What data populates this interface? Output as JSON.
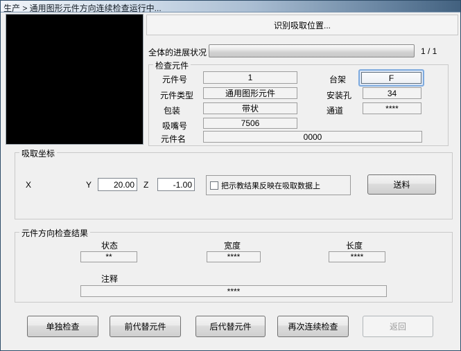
{
  "window": {
    "title": "生产 > 通用图形元件方向连续检查运行中...",
    "status_banner": "识别吸取位置...",
    "progress": {
      "label": "全体的进展状况",
      "count_text": "1 / 1"
    }
  },
  "inspect_group": {
    "title": "检查元件",
    "fields": {
      "part_no": {
        "label": "元件号",
        "value": "1"
      },
      "stage": {
        "label": "台架",
        "value": "F"
      },
      "part_type": {
        "label": "元件类型",
        "value": "通用图形元件"
      },
      "mount_hole": {
        "label": "安装孔",
        "value": "34"
      },
      "package": {
        "label": "包装",
        "value": "带状"
      },
      "channel": {
        "label": "通道",
        "value": "****"
      },
      "nozzle_no": {
        "label": "吸嘴号",
        "value": "7506"
      },
      "part_name": {
        "label": "元件名",
        "value": "0000"
      }
    }
  },
  "pickup_group": {
    "title": "吸取坐标",
    "x": {
      "label": "X"
    },
    "y": {
      "label": "Y",
      "value": "20.00"
    },
    "z": {
      "label": "Z",
      "value": "-1.00"
    },
    "teach_checkbox": {
      "label": "把示教结果反映在吸取数据上",
      "checked": false
    },
    "feed_button": "送料"
  },
  "result_group": {
    "title": "元件方向检查结果",
    "status": {
      "label": "状态",
      "value": "**"
    },
    "width": {
      "label": "宽度",
      "value": "****"
    },
    "length": {
      "label": "长度",
      "value": "****"
    },
    "comment": {
      "label": "注释",
      "value": "****"
    }
  },
  "buttons": {
    "single_check": "单独检查",
    "prev_substitute": "前代替元件",
    "next_substitute": "后代替元件",
    "recheck_continuous": "再次连续检查",
    "back": "返回"
  },
  "colors": {
    "focus_ring": "#7daade",
    "titlebar_left": "#f0f4f9",
    "titlebar_right": "#42617f",
    "client_background": "#f0f0f0"
  }
}
